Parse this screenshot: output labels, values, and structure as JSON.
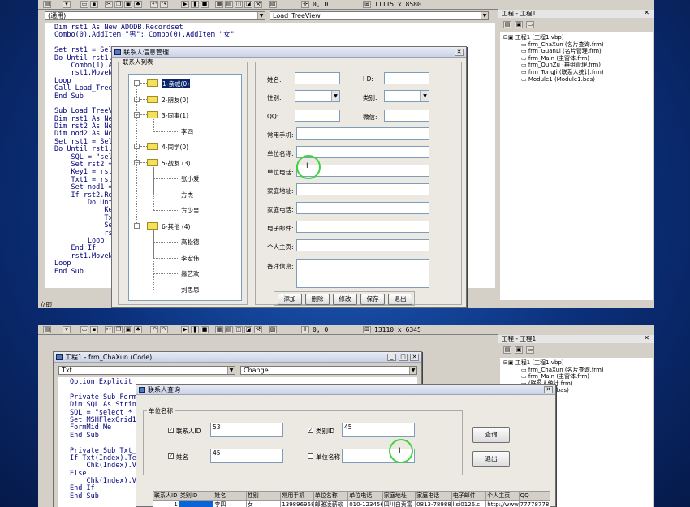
{
  "top": {
    "coord": "0, 0",
    "size": "11115 x 8580",
    "object_combo": "(通用)",
    "proc_combo": "Load_TreeView",
    "code_lines": [
      "Dim rst1 As New ADODB.Recordset",
      "Combo(0).AddItem \"男\": Combo(0).AddItem \"女\"",
      "",
      "Set rst1 = Sele",
      "Do Until rst1.",
      "    Combo(1).A",
      "    rst1.MoveN",
      "Loop",
      "Call Load_Tree",
      "End Sub",
      "",
      "Sub Load_TreeV",
      "Dim rst1 As Ne",
      "Dim rst2 As Ne",
      "Dim nod2 As No",
      "Set rst1 = Sel",
      "Do Until rst1.",
      "    SQL = \"sel",
      "    Set rst2 =",
      "    Key1 = rst",
      "    Txt1 = rst",
      "    Set nod1 =",
      "    If rst2.Re",
      "        Do Unt",
      "            Ke",
      "            Tx",
      "            Se",
      "            rs",
      "        Loop",
      "    End If",
      "    rst1.MoveN",
      "Loop",
      "End Sub"
    ],
    "status_text": "立即",
    "project": {
      "title": "工程 - 工程1",
      "items": [
        "工程1 (工程1.vbp)",
        "frm_ChaXun (名片查询.frm)",
        "frm_GuanLi (名片管理.frm)",
        "frm_Main (主窗体.frm)",
        "frm_QunZu (群组管理.frm)",
        "frm_TongJi (联系人统计.frm)",
        "Module1 (Module1.bas)"
      ]
    },
    "dialog": {
      "title": "联系人信息管理",
      "group_label": "联系人列表",
      "tree": [
        {
          "label": "1-亲戚(0)",
          "selected": true
        },
        {
          "label": "2-朋友(0)"
        },
        {
          "label": "3-同事(1)"
        },
        {
          "label": "李四",
          "child": true
        },
        {
          "label": "4-同学(0)"
        },
        {
          "label": "5-战友 (3)"
        },
        {
          "label": "张小爱",
          "child": true
        },
        {
          "label": "方杰",
          "child": true
        },
        {
          "label": "方少皇",
          "child": true
        },
        {
          "label": "6-其他 (4)"
        },
        {
          "label": "高松德",
          "child": true
        },
        {
          "label": "李宏伟",
          "child": true
        },
        {
          "label": "缘艺欢",
          "child": true
        },
        {
          "label": "刘思思",
          "child": true
        }
      ],
      "labels": {
        "name": "姓名:",
        "id": "I D:",
        "sex": "性别:",
        "category": "类别:",
        "qq": "QQ:",
        "wechat": "微信:",
        "mobile": "常用手机:",
        "company": "单位名称:",
        "company_phone": "单位电话:",
        "home_addr": "家庭地址:",
        "home_phone": "家庭电话:",
        "email": "电子邮件:",
        "homepage": "个人主页:",
        "notes": "备注信息:"
      },
      "buttons": {
        "add": "添加",
        "delete": "删除",
        "edit": "修改",
        "save": "保存",
        "exit": "退出"
      }
    }
  },
  "bottom": {
    "coord": "0, 0",
    "size": "13110 x 6345",
    "code_window_title": "工程1 - frm_ChaXun (Code)",
    "object_combo": "Txt",
    "proc_combo": "Change",
    "code_lines": [
      "Option Explicit",
      "",
      "Private Sub Form_",
      "Dim SQL As String",
      "SQL = \"select * f",
      "Set MSHFlexGrid1.",
      "FormMid Me",
      "End Sub",
      "",
      "Private Sub Txt_C",
      "If Txt(Index).Tex",
      "    Chk(Index).Va",
      "Else",
      "    Chk(Index).Va",
      "End If",
      "End Sub"
    ],
    "project": {
      "title": "工程 - 工程1",
      "items": [
        "工程1 (工程1.vbp)",
        "frm_ChaXun (名片查询.frm)",
        "frm_Main (主窗体.frm)",
        "(联系人统计.frm)",
        "(Module1.bas)"
      ]
    },
    "dialog": {
      "title": "联系人查询",
      "group_label": "单位名称",
      "contact_id_label": "联系人ID",
      "contact_id_value": "53",
      "category_id_label": "类别ID",
      "category_id_value": "45",
      "name_label": "姓名",
      "name_value": "45",
      "company_label": "单位名称",
      "company_value": "",
      "query_button": "查询",
      "exit_button": "退出"
    },
    "grid": {
      "headers": [
        "联系人ID",
        "类别ID",
        "姓名",
        "性别",
        "常用手机",
        "单位名称",
        "单位电话",
        "家庭地址",
        "家庭电话",
        "电子邮件",
        "个人主页",
        "QQ"
      ],
      "row": [
        "1",
        "",
        "李四",
        "女",
        "1398969685",
        "邮雅凌薪软",
        "010-123456",
        "四川自贡富",
        "0813-78988",
        "lisi0126.c",
        "http://www",
        "77778778"
      ]
    }
  }
}
